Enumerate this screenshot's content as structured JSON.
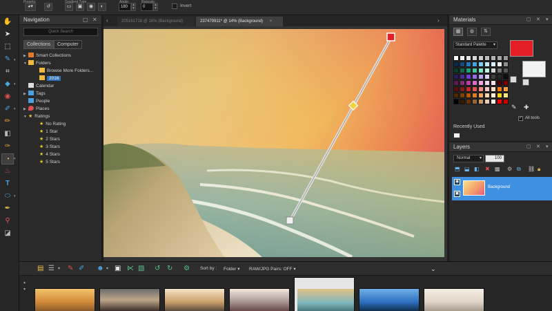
{
  "toolbar": {
    "preset_label": "Presets:",
    "gradient_type_label": "Gradient Type:",
    "angle_label": "Angle:",
    "angle_value": "180",
    "repeats_label": "Repeats:",
    "repeats_value": "0",
    "invert_label": "Invert"
  },
  "navigation": {
    "title": "Navigation",
    "search_placeholder": "Quick Search",
    "tabs": [
      "Collections",
      "Computer"
    ],
    "tree": [
      {
        "label": "Smart Collections",
        "indent": 0,
        "arrow": "▶",
        "icon": "smart-collections-icon"
      },
      {
        "label": "Folders",
        "indent": 0,
        "arrow": "▼",
        "icon": "folder-icon"
      },
      {
        "label": "Browse More Folders...",
        "indent": 1,
        "arrow": "",
        "icon": "folder-icon"
      },
      {
        "label": "2016",
        "indent": 1,
        "arrow": "",
        "icon": "folder-icon",
        "selected": true
      },
      {
        "label": "Calendar",
        "indent": 0,
        "arrow": "",
        "icon": "calendar-icon"
      },
      {
        "label": "Tags",
        "indent": 0,
        "arrow": "▶",
        "icon": "tag-icon"
      },
      {
        "label": "People",
        "indent": 0,
        "arrow": "",
        "icon": "people-icon"
      },
      {
        "label": "Places",
        "indent": 0,
        "arrow": "▶",
        "icon": "places-pin-icon"
      },
      {
        "label": "Ratings",
        "indent": 0,
        "arrow": "▼",
        "icon": "star-icon"
      },
      {
        "label": "No Rating",
        "indent": 1,
        "arrow": "",
        "icon": "star-icon"
      },
      {
        "label": "1 Star",
        "indent": 1,
        "arrow": "",
        "icon": "star-icon"
      },
      {
        "label": "2 Stars",
        "indent": 1,
        "arrow": "",
        "icon": "star-icon"
      },
      {
        "label": "3 Stars",
        "indent": 1,
        "arrow": "",
        "icon": "star-icon"
      },
      {
        "label": "4 Stars",
        "indent": 1,
        "arrow": "",
        "icon": "star-icon"
      },
      {
        "label": "5 Stars",
        "indent": 1,
        "arrow": "",
        "icon": "star-icon"
      }
    ]
  },
  "documents": {
    "tabs": [
      {
        "title": "205161718 @  16% (Background)",
        "active": false
      },
      {
        "title": "237479911* @  14% (Background)",
        "active": true
      }
    ],
    "close_glyph": "×"
  },
  "materials": {
    "title": "Materials",
    "palette_label": "Standard Palette",
    "foreground_color": "#e41f26",
    "background_color": "#f2f2f2",
    "recently_used_label": "Recently Used",
    "all_tools_label": "All tools",
    "swatches": [
      "#ffffff",
      "#f2f2f2",
      "#e6e6e6",
      "#d9d9d9",
      "#cccccc",
      "#bfbfbf",
      "#b3b3b3",
      "#a6a6a6",
      "#999999",
      "#0a2a4a",
      "#0f4c81",
      "#1f77b4",
      "#3fa7e0",
      "#7fcdf0",
      "#bfe9f8",
      "#d8f1fb",
      "#ececec",
      "#8c8c8c",
      "#0b3d2e",
      "#0f6b4f",
      "#1aa37a",
      "#3fc7a2",
      "#7fe3c8",
      "#bff2e4",
      "#d9d9d9",
      "#737373",
      "#595959",
      "#2c1a5a",
      "#4b2a99",
      "#6b3fd1",
      "#8f6ee6",
      "#b9a3f2",
      "#dcd1f9",
      "#404040",
      "#262626",
      "#0d0d0d",
      "#5a1a4d",
      "#8a2a78",
      "#b93fa3",
      "#d76ec3",
      "#ebaadf",
      "#f5d4ef",
      "#f8e0e8",
      "#4d0000",
      "#7a0000",
      "#5a0d0d",
      "#8a1a1a",
      "#c02a2a",
      "#e05050",
      "#f08a8a",
      "#f8c4c4",
      "#ffe0cc",
      "#ff7a00",
      "#ff9f3f",
      "#4d2600",
      "#804000",
      "#b35900",
      "#e07a1f",
      "#f0a55c",
      "#f8d2a8",
      "#fff0d6",
      "#ffd700",
      "#ffe680",
      "#000000",
      "#331a00",
      "#663300",
      "#996633",
      "#cc9966",
      "#e6ccb3",
      "#fff5e6",
      "#ff0000",
      "#cc0000"
    ]
  },
  "layers": {
    "title": "Layers",
    "blend_mode": "Normal",
    "opacity": "100",
    "layer_name": "Background"
  },
  "organizer": {
    "sort_label": "Sort by :",
    "sort_value": "Folder",
    "raw_pairs": "RAW/JPG Pairs: OFF",
    "thumbnails": [
      {
        "gradient": "linear-gradient(180deg,#f3c26b,#d28a3a 60%,#8a5a2a)"
      },
      {
        "gradient": "linear-gradient(180deg,#6b6b6b,#bfa68a 50%,#3d2f28)"
      },
      {
        "gradient": "linear-gradient(180deg,#f5e3c8,#c99e6a 60%,#5a4a3a)"
      },
      {
        "gradient": "linear-gradient(180deg,#f2e6df,#b5a3a0 50%,#6a4a4a)"
      },
      {
        "gradient": "selected"
      },
      {
        "gradient": "linear-gradient(180deg,#6fb0e8,#2c6fbf 60%,#10304f)"
      },
      {
        "gradient": "linear-gradient(180deg,#f5efe6,#ded3c5 60%,#a89c8f)"
      }
    ]
  }
}
